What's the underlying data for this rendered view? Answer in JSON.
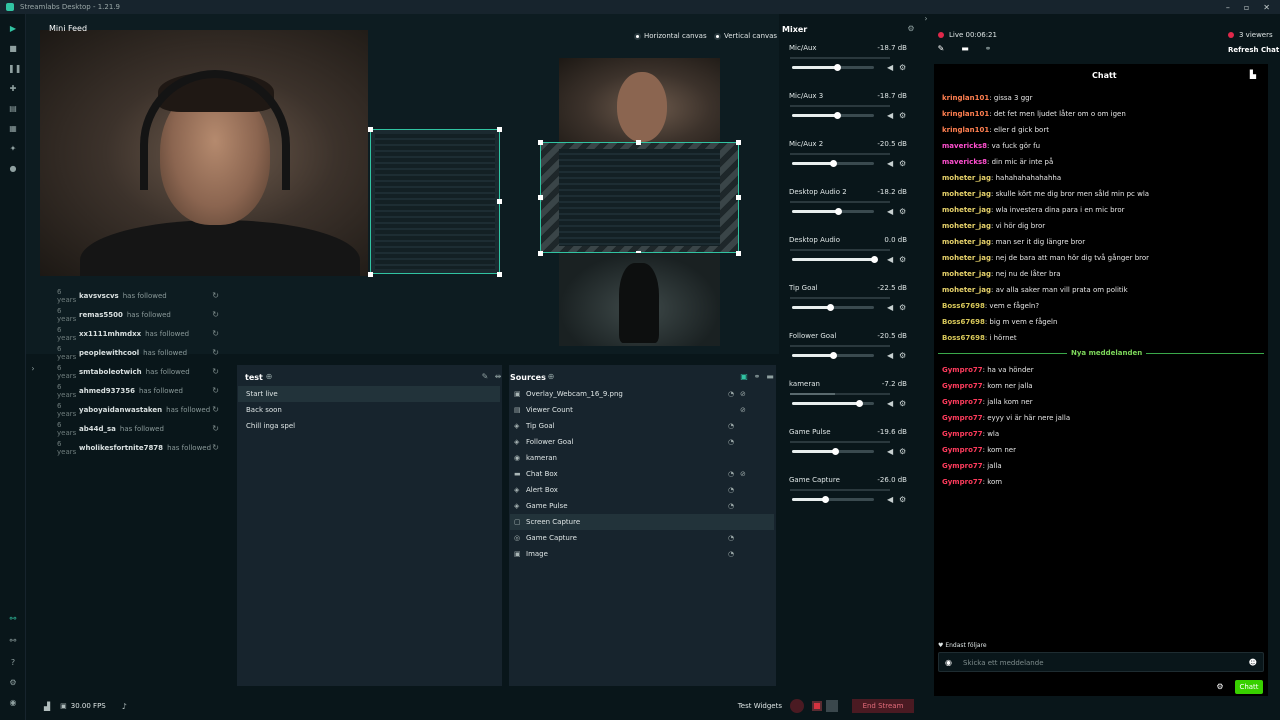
{
  "window": {
    "title": "Streamlabs Desktop - 1.21.9"
  },
  "editor": {
    "mini_feed_title": "Mini Feed",
    "horizontal_canvas": "Horizontal canvas",
    "vertical_canvas": "Vertical canvas"
  },
  "feed": [
    {
      "age": "6 years",
      "user": "kavsvscvs",
      "action": "has followed"
    },
    {
      "age": "6 years",
      "user": "remas5500",
      "action": "has followed"
    },
    {
      "age": "6 years",
      "user": "xx1111mhmdxx",
      "action": "has followed"
    },
    {
      "age": "6 years",
      "user": "peoplewithcool",
      "action": "has followed"
    },
    {
      "age": "6 years",
      "user": "smtaboleotwich",
      "action": "has followed"
    },
    {
      "age": "6 years",
      "user": "ahmed937356",
      "action": "has followed"
    },
    {
      "age": "6 years",
      "user": "yaboyaidanwastaken",
      "action": "has followed"
    },
    {
      "age": "6 years",
      "user": "ab44d_sa",
      "action": "has followed"
    },
    {
      "age": "6 years",
      "user": "wholikesfortnite7878",
      "action": "has followed"
    }
  ],
  "scenes": {
    "title": "test",
    "items": [
      "Start live",
      "Back soon",
      "Chill inga spel"
    ]
  },
  "sources": {
    "title": "Sources",
    "items": [
      "Overlay_Webcam_16_9.png",
      "Viewer Count",
      "Tip Goal",
      "Follower Goal",
      "kameran",
      "Chat Box",
      "Alert Box",
      "Game Pulse",
      "Screen Capture",
      "Game Capture",
      "Image"
    ]
  },
  "mixer": {
    "title": "Mixer",
    "channels": [
      {
        "name": "Mic/Aux",
        "db": "-18.7 dB",
        "level": 0.55
      },
      {
        "name": "Mic/Aux 3",
        "db": "-18.7 dB",
        "level": 0.55
      },
      {
        "name": "Mic/Aux 2",
        "db": "-20.5 dB",
        "level": 0.5
      },
      {
        "name": "Desktop Audio 2",
        "db": "-18.2 dB",
        "level": 0.56
      },
      {
        "name": "Desktop Audio",
        "db": "0.0 dB",
        "level": 1.0
      },
      {
        "name": "Tip Goal",
        "db": "-22.5 dB",
        "level": 0.46
      },
      {
        "name": "Follower Goal",
        "db": "-20.5 dB",
        "level": 0.5
      },
      {
        "name": "kameran",
        "db": "-7.2 dB",
        "level": 0.82
      },
      {
        "name": "Game Pulse",
        "db": "-19.6 dB",
        "level": 0.52
      },
      {
        "name": "Game Capture",
        "db": "-26.0 dB",
        "level": 0.4
      }
    ]
  },
  "chat": {
    "live_label": "Live 00:06:21",
    "viewers": "3 viewers",
    "refresh": "Refresh Chat",
    "title": "Chatt",
    "messages": [
      {
        "user": "kringlan101",
        "text": ": gissa 3 ggr",
        "color": "#ff7f50"
      },
      {
        "user": "kringlan101",
        "text": ": det fet men ljudet låter om o om igen",
        "color": "#ff7f50"
      },
      {
        "user": "kringlan101",
        "text": ": eller d gick bort",
        "color": "#ff7f50"
      },
      {
        "user": "mavericks8",
        "text": ": va fuck gör fu",
        "color": "#ff4fcf"
      },
      {
        "user": "mavericks8",
        "text": ": din mic är inte på",
        "color": "#ff4fcf"
      },
      {
        "user": "moheter_jag",
        "text": ": hahahahahahahha",
        "color": "#e8d36b"
      },
      {
        "user": "moheter_jag",
        "text": ": skulle kört me dig bror men såld min pc wla",
        "color": "#e8d36b"
      },
      {
        "user": "moheter_jag",
        "text": ": wla investera dina para i en mic bror",
        "color": "#e8d36b"
      },
      {
        "user": "moheter_jag",
        "text": ": vi hör dig bror",
        "color": "#e8d36b"
      },
      {
        "user": "moheter_jag",
        "text": ": man ser it dig längre bror",
        "color": "#e8d36b"
      },
      {
        "user": "moheter_jag",
        "text": ": nej de bara att man hör dig två gånger bror",
        "color": "#e8d36b"
      },
      {
        "user": "moheter_jag",
        "text": ": nej nu de låter bra",
        "color": "#e8d36b"
      },
      {
        "user": "moheter_jag",
        "text": ": av alla saker man vill prata om politik",
        "color": "#e8d36b"
      },
      {
        "user": "Boss67698",
        "text": ": vem e fågeln?",
        "color": "#d8c85a"
      },
      {
        "user": "Boss67698",
        "text": ": big m vem e fågeln",
        "color": "#d8c85a"
      },
      {
        "user": "Boss67698",
        "text": ": i hörnet",
        "color": "#d8c85a"
      }
    ],
    "new_messages_label": "Nya meddelanden",
    "new_messages": [
      {
        "user": "Gympro77",
        "text": ": ha va hönder",
        "color": "#ff3b5c"
      },
      {
        "user": "Gympro77",
        "text": ": kom ner jalla",
        "color": "#ff3b5c"
      },
      {
        "user": "Gympro77",
        "text": ": jalla kom ner",
        "color": "#ff3b5c"
      },
      {
        "user": "Gympro77",
        "text": ": eyyy vi är här nere jalla",
        "color": "#ff3b5c"
      },
      {
        "user": "Gympro77",
        "text": ": wla",
        "color": "#ff3b5c"
      },
      {
        "user": "Gympro77",
        "text": ": kom ner",
        "color": "#ff3b5c"
      },
      {
        "user": "Gympro77",
        "text": ": jalla",
        "color": "#ff3b5c"
      },
      {
        "user": "Gympro77",
        "text": ": kom",
        "color": "#ff3b5c"
      }
    ],
    "followers_only": "Endast följare",
    "input_placeholder": "Skicka ett meddelande",
    "send_button": "Chatt"
  },
  "status": {
    "fps": "30.00 FPS",
    "test_widgets": "Test Widgets",
    "end_stream": "End Stream"
  },
  "colors": {
    "accent": "#31c3a2",
    "end_stream": "#b63b4b",
    "chat_send": "#38d000"
  }
}
